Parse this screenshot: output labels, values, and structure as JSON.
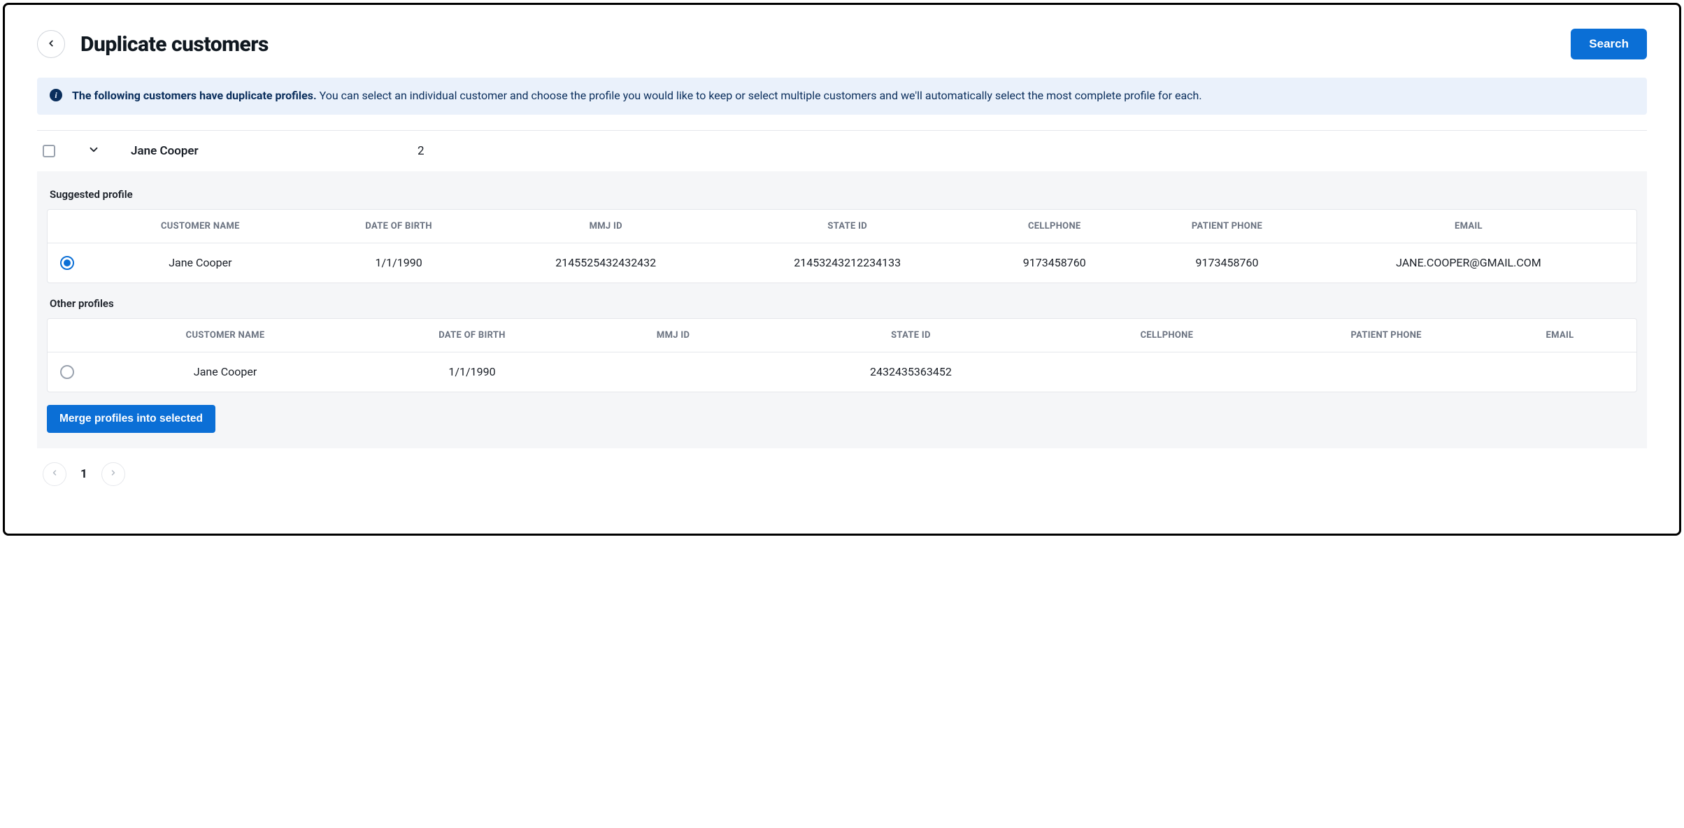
{
  "header": {
    "title": "Duplicate customers",
    "search_label": "Search"
  },
  "info": {
    "bold": "The following customers have duplicate profiles.",
    "rest": " You can select an individual customer and choose the profile you would like to keep or select multiple customers and we'll automatically select the most complete profile for each."
  },
  "group": {
    "name": "Jane Cooper",
    "count": "2"
  },
  "sections": {
    "suggested_label": "Suggested profile",
    "other_label": "Other profiles"
  },
  "columns": {
    "customer_name": "CUSTOMER NAME",
    "dob": "DATE OF BIRTH",
    "mmj_id": "MMJ ID",
    "state_id": "STATE ID",
    "cellphone": "CELLPHONE",
    "patient_phone": "PATIENT PHONE",
    "email": "EMAIL"
  },
  "suggested_row": {
    "name": "Jane Cooper",
    "dob": "1/1/1990",
    "mmj_id": "2145525432432432",
    "state_id": "21453243212234133",
    "cellphone": "9173458760",
    "patient_phone": "9173458760",
    "email": "JANE.COOPER@GMAIL.COM"
  },
  "other_row": {
    "name": "Jane Cooper",
    "dob": "1/1/1990",
    "mmj_id": "",
    "state_id": "2432435363452",
    "cellphone": "",
    "patient_phone": "",
    "email": ""
  },
  "merge": {
    "label": "Merge profiles into selected"
  },
  "pagination": {
    "current": "1"
  }
}
